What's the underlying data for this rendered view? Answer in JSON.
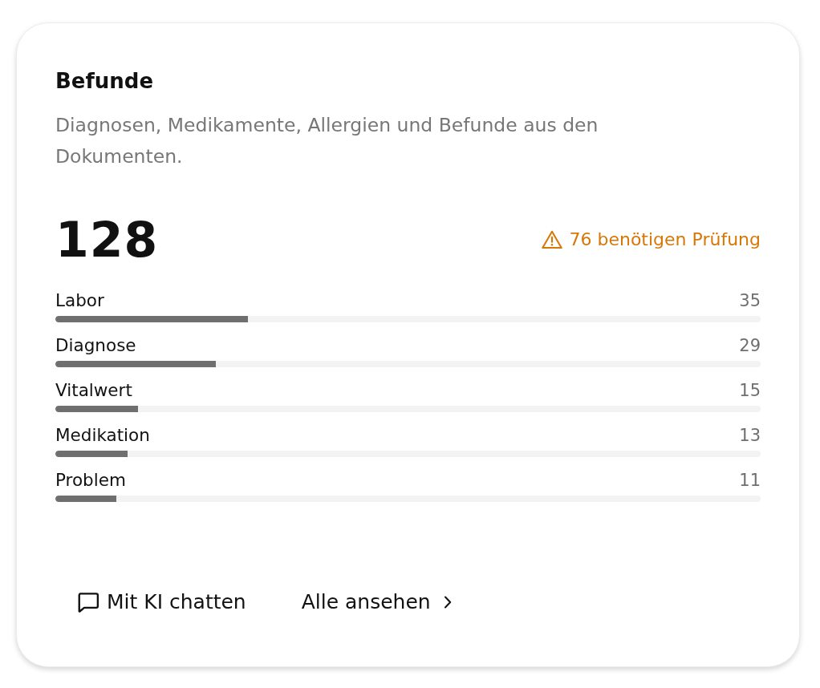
{
  "card": {
    "title": "Befunde",
    "description": "Diagnosen, Medikamente, Allergien und Befunde aus den Dokumenten.",
    "total": "128",
    "review_notice": "76 benötigen Prüfung"
  },
  "categories": [
    {
      "label": "Labor",
      "count": "35",
      "level": 0.273
    },
    {
      "label": "Diagnose",
      "count": "29",
      "level": 0.227
    },
    {
      "label": "Vitalwert",
      "count": "15",
      "level": 0.117
    },
    {
      "label": "Medikation",
      "count": "13",
      "level": 0.102
    },
    {
      "label": "Problem",
      "count": "11",
      "level": 0.086
    }
  ],
  "actions": [
    {
      "kind": "chat",
      "label": "Mit KI chatten"
    },
    {
      "kind": "link",
      "label": "Alle ansehen"
    }
  ]
}
